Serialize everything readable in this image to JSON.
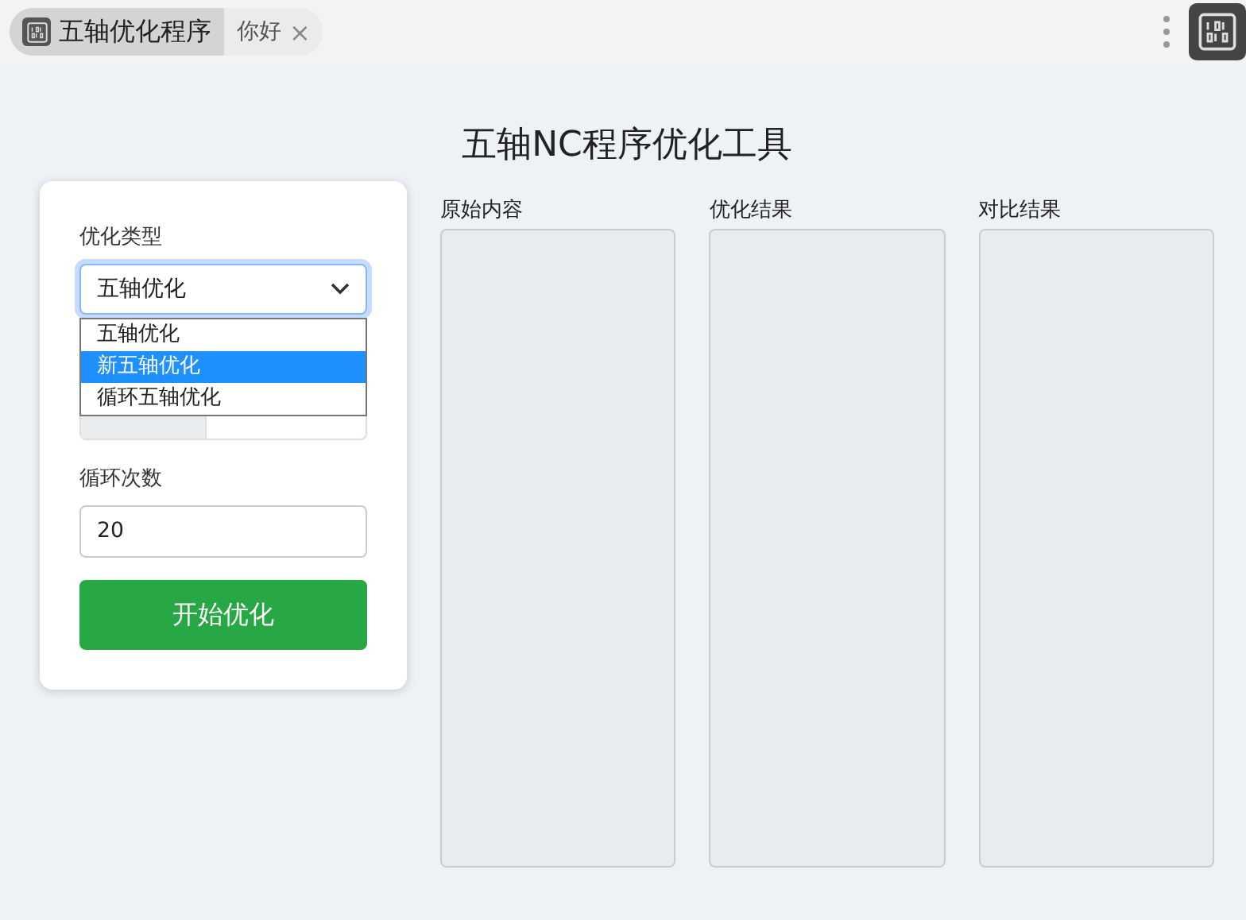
{
  "tabs": [
    {
      "label": "五轴优化程序",
      "selected": true,
      "kind": "app"
    },
    {
      "label": "你好",
      "selected": false,
      "kind": "page",
      "close": "×"
    }
  ],
  "title": "五轴NC程序优化工具",
  "form": {
    "type_label": "优化类型",
    "type_value": "五轴优化",
    "dropdown_open": true,
    "options": [
      {
        "label": "五轴优化",
        "selected": false
      },
      {
        "label": "新五轴优化",
        "selected": true
      },
      {
        "label": "循环五轴优化",
        "selected": false
      }
    ],
    "loop_label": "循环次数",
    "loop_value": "20",
    "start_button": "开始优化"
  },
  "panels": [
    {
      "label": "原始内容"
    },
    {
      "label": "优化结果"
    },
    {
      "label": "对比结果"
    }
  ]
}
